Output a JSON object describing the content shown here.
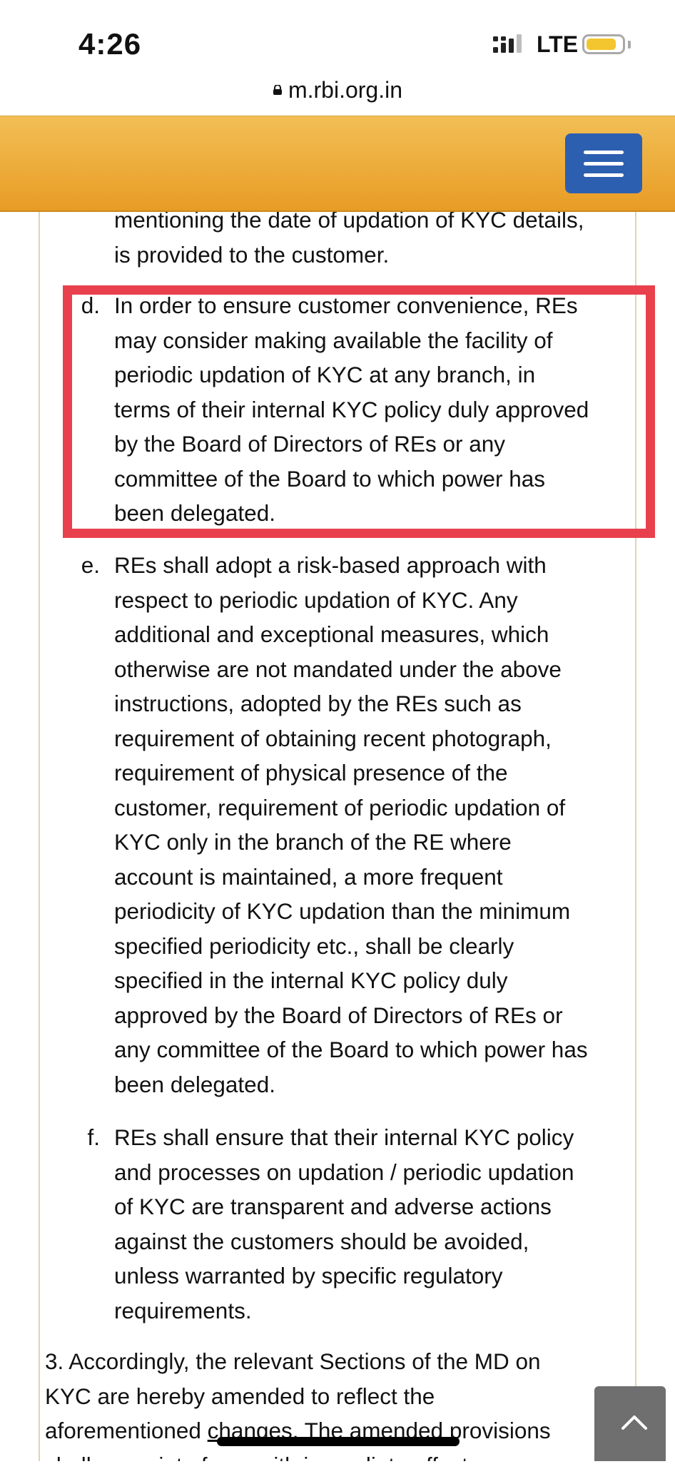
{
  "status_bar": {
    "time": "4:26",
    "network": "LTE"
  },
  "browser": {
    "url": "m.rbi.org.in"
  },
  "article": {
    "prev_tail": [
      "mentioning the date of updation of KYC details,",
      "is provided to the customer."
    ],
    "items": [
      {
        "marker": "d.",
        "lines": [
          "In order to ensure customer convenience, REs",
          "may consider making available the facility of",
          "periodic updation of KYC at any branch, in",
          "terms of their internal KYC policy duly approved",
          "by the Board of Directors of REs or any",
          "committee of the Board to which power has",
          "been delegated."
        ]
      },
      {
        "marker": "e.",
        "lines": [
          "REs shall adopt a risk-based approach with",
          "respect to periodic updation of KYC. Any",
          "additional and exceptional measures, which",
          "otherwise are not mandated under the above",
          "instructions, adopted by the REs such as",
          "requirement of obtaining recent photograph,",
          "requirement of physical presence of the",
          "customer, requirement of periodic updation of",
          "KYC only in the branch of the RE where",
          "account is maintained, a more frequent",
          "periodicity of KYC updation than the minimum",
          "specified periodicity etc., shall be clearly",
          "specified in the internal KYC policy duly",
          "approved by the Board of Directors of REs or",
          "any committee of the Board to which power has",
          "been delegated."
        ]
      },
      {
        "marker": "f.",
        "lines": [
          "REs shall ensure that their internal KYC policy",
          "and processes on updation / periodic updation",
          "of KYC are transparent and adverse actions",
          "against the customers should be avoided,",
          "unless warranted by specific regulatory",
          "requirements."
        ]
      }
    ],
    "para3": {
      "line1": "3. Accordingly, the relevant Sections of the MD on",
      "line2": "KYC are hereby amended to reflect the",
      "line3_a": "aforementioned ",
      "line3_b": "changes. The amended",
      "line3_c": " provisions",
      "line4": "shall come into force with immediate effect."
    }
  },
  "colors": {
    "header_top": "#f2bf55",
    "header_bottom": "#e89c25",
    "menu_button": "#2d5fb0",
    "highlight": "#e8414d",
    "battery": "#f3c52e"
  }
}
